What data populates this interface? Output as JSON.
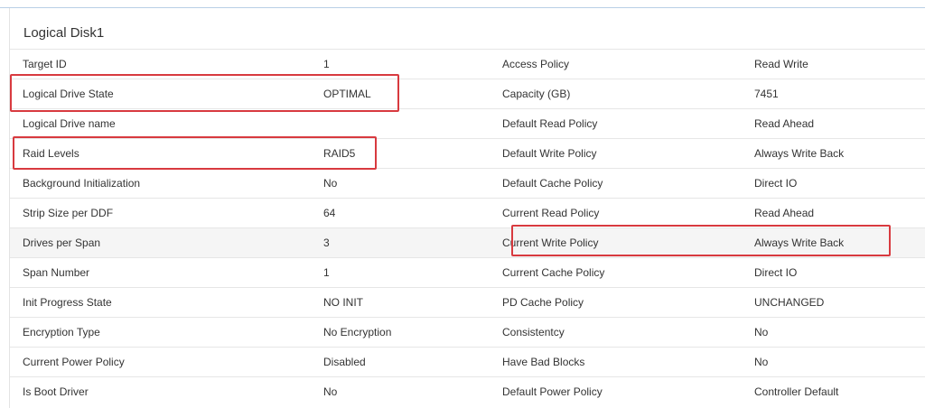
{
  "panel": {
    "title": "Logical Disk1"
  },
  "rows": [
    {
      "k1": "Target ID",
      "v1": "1",
      "k2": "Access Policy",
      "v2": "Read Write"
    },
    {
      "k1": "Logical Drive State",
      "v1": "OPTIMAL",
      "k2": "Capacity (GB)",
      "v2": "7451"
    },
    {
      "k1": "Logical Drive name",
      "v1": "",
      "k2": "Default Read Policy",
      "v2": "Read Ahead"
    },
    {
      "k1": "Raid Levels",
      "v1": "RAID5",
      "k2": "Default Write Policy",
      "v2": "Always Write Back"
    },
    {
      "k1": "Background Initialization",
      "v1": "No",
      "k2": "Default Cache Policy",
      "v2": "Direct IO"
    },
    {
      "k1": "Strip Size per DDF",
      "v1": "64",
      "k2": "Current Read Policy",
      "v2": "Read Ahead"
    },
    {
      "k1": "Drives per Span",
      "v1": "3",
      "k2": "Current Write Policy",
      "v2": "Always Write Back"
    },
    {
      "k1": "Span Number",
      "v1": "1",
      "k2": "Current Cache Policy",
      "v2": "Direct IO"
    },
    {
      "k1": "Init Progress State",
      "v1": "NO INIT",
      "k2": "PD Cache Policy",
      "v2": "UNCHANGED"
    },
    {
      "k1": "Encryption Type",
      "v1": "No Encryption",
      "k2": "Consistentcy",
      "v2": "No"
    },
    {
      "k1": "Current Power Policy",
      "v1": "Disabled",
      "k2": "Have Bad Blocks",
      "v2": "No"
    },
    {
      "k1": "Is Boot Driver",
      "v1": "No",
      "k2": "Default Power Policy",
      "v2": "Controller Default"
    }
  ],
  "highlight_color": "#d83a3f",
  "stripe_color": "#f5f5f5"
}
